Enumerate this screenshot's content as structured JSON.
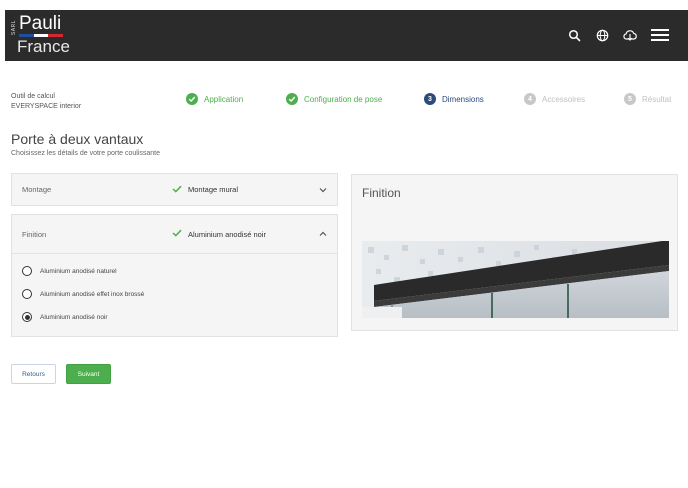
{
  "header": {
    "logo": {
      "sarl": "SARL",
      "name": "Pauli",
      "country": "France"
    },
    "icons": [
      "search-icon",
      "globe-icon",
      "cloud-download-icon",
      "menu-icon"
    ]
  },
  "calculator": {
    "line1": "Outil de calcul",
    "line2": "EVERYSPACE interior"
  },
  "steps": [
    {
      "label": "Application",
      "state": "done",
      "number": ""
    },
    {
      "label": "Configuration de pose",
      "state": "done",
      "number": ""
    },
    {
      "label": "Dimensions",
      "state": "active",
      "number": "3"
    },
    {
      "label": "Accessoires",
      "state": "pending",
      "number": "4"
    },
    {
      "label": "Résultat",
      "state": "pending",
      "number": "5"
    }
  ],
  "page": {
    "title": "Porte à deux vantaux",
    "subtitle": "Choisissez les détails de votre porte coulissante"
  },
  "montage": {
    "label": "Montage",
    "value": "Montage mural"
  },
  "finition": {
    "label": "Finition",
    "value": "Aluminium anodisé noir",
    "options": [
      {
        "label": "Aluminium anodisé naturel",
        "checked": false
      },
      {
        "label": "Aluminium anodisé effet inox brossé",
        "checked": false
      },
      {
        "label": "Aluminium anodisé noir",
        "checked": true
      }
    ]
  },
  "preview": {
    "title": "Finition"
  },
  "buttons": {
    "back": "Retours",
    "next": "Suivant"
  },
  "colors": {
    "header_bg": "#2b2b2b",
    "success": "#4cae4c",
    "active": "#2c4a7a",
    "pending": "#c8c8c8"
  }
}
